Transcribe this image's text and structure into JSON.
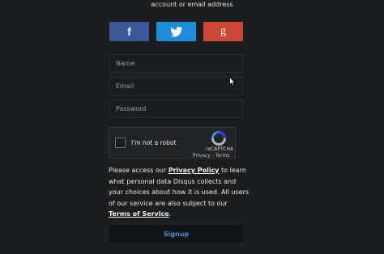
{
  "header": {
    "intro_text": "account or email address"
  },
  "social": {
    "facebook_label": "f",
    "twitter_icon": "twitter-bird-icon",
    "google_label": "g",
    "colors": {
      "facebook": "#3b5998",
      "twitter": "#1d8dd9",
      "google": "#cc4735"
    }
  },
  "form": {
    "name_placeholder": "Name",
    "email_placeholder": "Email",
    "password_placeholder": "Password"
  },
  "recaptcha": {
    "checkbox_label": "I'm not a robot",
    "brand": "reCAPTCHA",
    "privacy_link": "Privacy",
    "separator": " - ",
    "terms_link": "Terms",
    "logo_icon": "recaptcha-logo-icon"
  },
  "policy": {
    "text_before": "Please access our ",
    "privacy_link": "Privacy Policy",
    "text_middle": " to learn what personal data Disqus collects and your choices about how it is used. All users of our service are also subject to our ",
    "terms_link": "Terms of Service",
    "text_end": "."
  },
  "actions": {
    "signup_label": "Signup",
    "signup_color": "#4a90d9"
  }
}
